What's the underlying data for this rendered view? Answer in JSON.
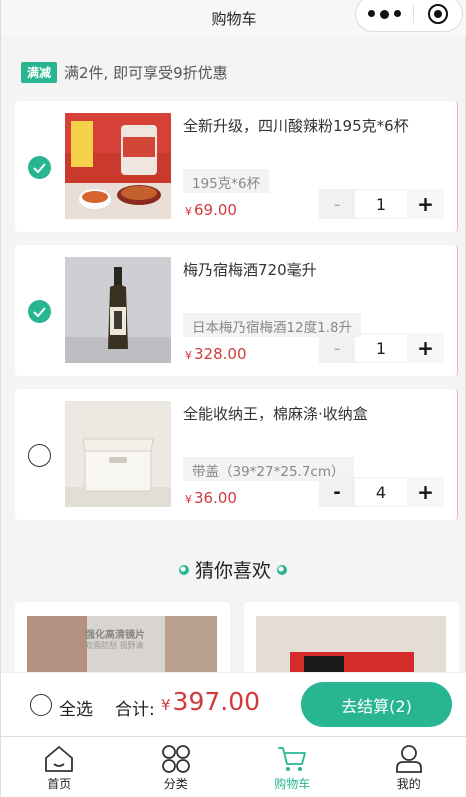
{
  "header": {
    "title": "购物车"
  },
  "promo": {
    "tag": "满减",
    "text": "满2件, 即可享受9折优惠"
  },
  "cart": {
    "items": [
      {
        "name": "全新升级，四川酸辣粉195克*6杯",
        "spec": "195克*6杯",
        "currency": "¥",
        "price": "69.00",
        "qty": "1",
        "selected": true,
        "minus": "-",
        "plus": "+"
      },
      {
        "name": "梅乃宿梅酒720毫升",
        "spec": "日本梅乃宿梅酒12度1.8升",
        "currency": "¥",
        "price": "328.00",
        "qty": "1",
        "selected": true,
        "minus": "-",
        "plus": "+"
      },
      {
        "name": "全能收纳王，棉麻涤·收纳盒",
        "spec": "带盖（39*27*25.7cm）",
        "currency": "¥",
        "price": "36.00",
        "qty": "4",
        "selected": false,
        "minus": "-",
        "plus": "+"
      }
    ]
  },
  "recommend": {
    "title": "猜你喜欢",
    "card1_text": "强化高清镜片",
    "card1_sub": "双面防刮 视野清"
  },
  "footer": {
    "select_all": "全选",
    "total_label": "合计:",
    "currency": "¥",
    "total": "397.00",
    "checkout": "去结算(2)"
  },
  "tabbar": {
    "items": [
      {
        "label": "首页",
        "icon": "home-icon"
      },
      {
        "label": "分类",
        "icon": "category-icon"
      },
      {
        "label": "购物车",
        "icon": "cart-icon"
      },
      {
        "label": "我的",
        "icon": "profile-icon"
      }
    ],
    "active_index": 2
  },
  "colors": {
    "accent": "#27b592",
    "price": "#d03a3a"
  }
}
